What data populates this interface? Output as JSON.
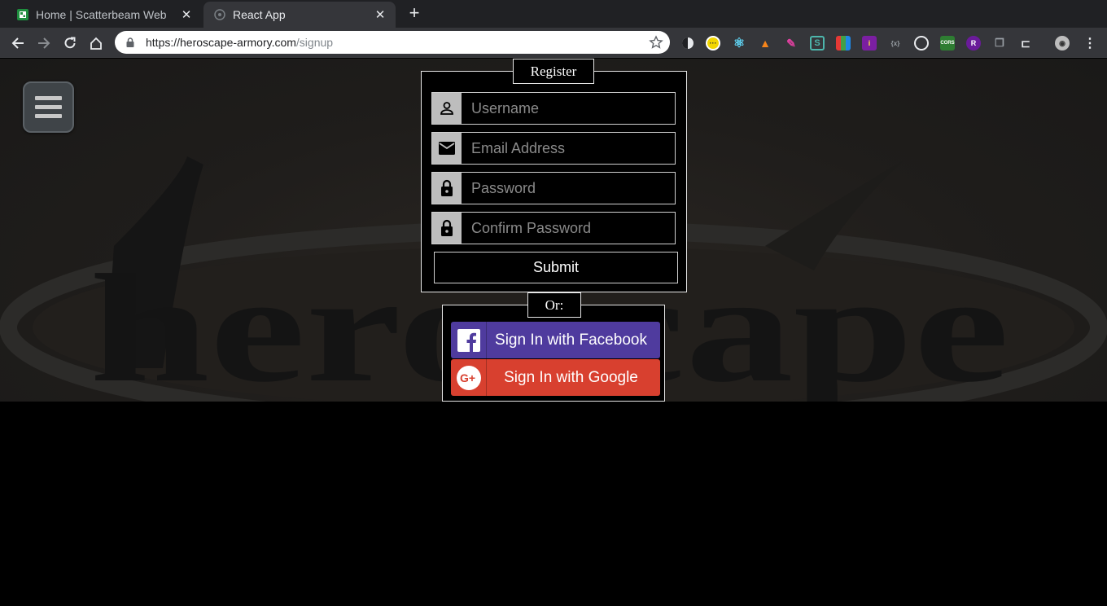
{
  "browser": {
    "tabs": [
      {
        "title": "Home | Scatterbeam Web",
        "active": false
      },
      {
        "title": "React App",
        "active": true
      }
    ],
    "url_domain": "https://heroscape-armory.com",
    "url_path": "/signup"
  },
  "register": {
    "legend": "Register",
    "username_placeholder": "Username",
    "email_placeholder": "Email Address",
    "password_placeholder": "Password",
    "confirm_placeholder": "Confirm Password",
    "submit_label": "Submit"
  },
  "social": {
    "legend": "Or:",
    "facebook_label": "Sign In with Facebook",
    "google_label": "Sign In with Google"
  },
  "colors": {
    "facebook": "#4f3b9e",
    "google": "#d8402f"
  }
}
